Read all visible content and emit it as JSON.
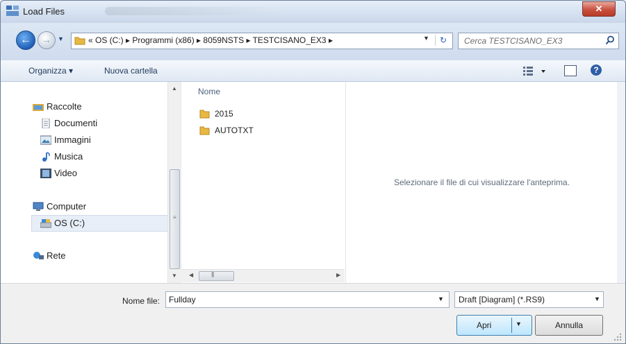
{
  "window": {
    "title": "Load Files",
    "close_glyph": "✕"
  },
  "colors": {
    "accent": "#3c7fb1",
    "folder": "#e8b842",
    "close": "#c9503e"
  },
  "address": {
    "back_icon": "back-arrow-icon",
    "forward_icon": "forward-arrow-icon",
    "path_text": "«  OS (C:)  ▸  Programmi (x86)  ▸  8059NSTS  ▸  TESTCISANO_EX3  ▸",
    "search_placeholder": "Cerca TESTCISANO_EX3"
  },
  "toolbar": {
    "organize": "Organizza ▾",
    "new_folder": "Nuova cartella"
  },
  "nav": {
    "items": [
      {
        "label": "Raccolte",
        "icon": "libraries-icon"
      },
      {
        "label": "Documenti",
        "icon": "documents-icon"
      },
      {
        "label": "Immagini",
        "icon": "pictures-icon"
      },
      {
        "label": "Musica",
        "icon": "music-icon"
      },
      {
        "label": "Video",
        "icon": "video-icon"
      },
      {
        "label": "Computer",
        "icon": "computer-icon"
      },
      {
        "label": "OS (C:)",
        "icon": "drive-icon",
        "selected": true
      },
      {
        "label": "Rete",
        "icon": "network-icon"
      }
    ]
  },
  "files": {
    "column_header": "Nome",
    "items": [
      {
        "name": "2015",
        "type": "folder"
      },
      {
        "name": "AUTOTXT",
        "type": "folder"
      }
    ]
  },
  "preview": {
    "message": "Selezionare il file di cui visualizzare l'anteprima."
  },
  "footer": {
    "filename_label": "Nome file:",
    "filename_value": "Fullday",
    "filetype_value": "Draft [Diagram]  (*.RS9)",
    "open_label": "Apri",
    "cancel_label": "Annulla"
  }
}
